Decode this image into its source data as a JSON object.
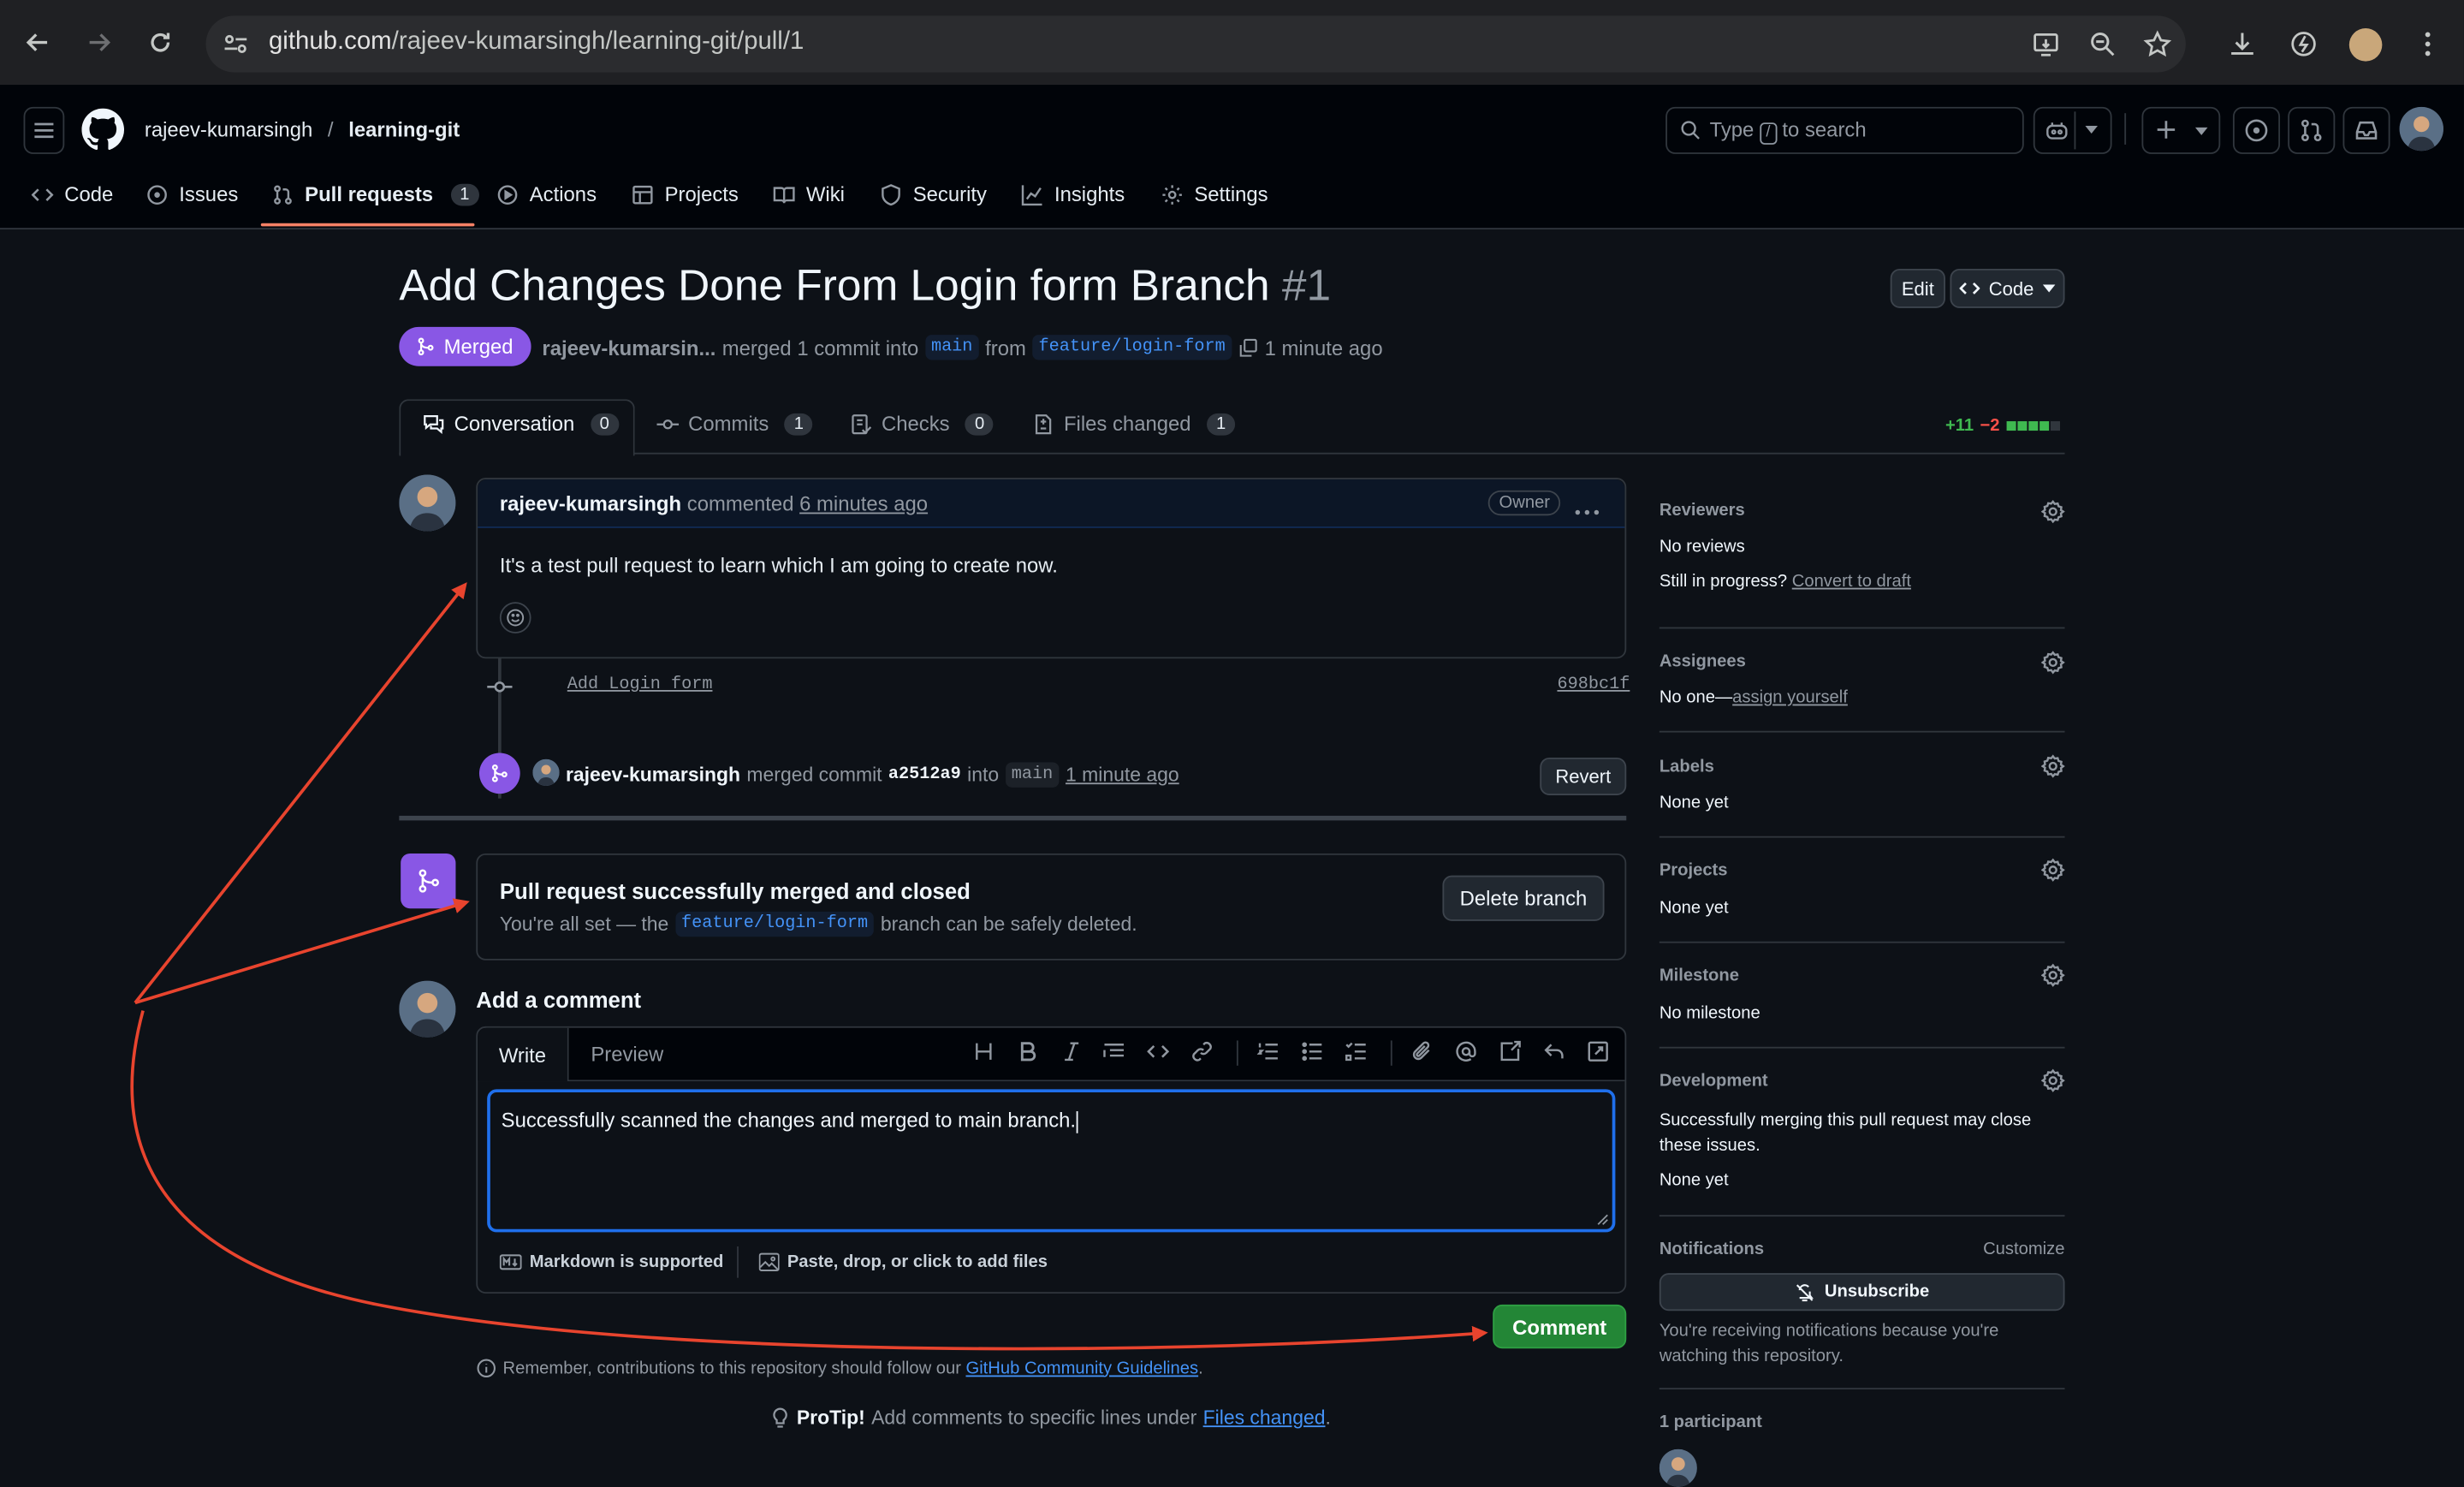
{
  "browser": {
    "url_host": "github.com",
    "url_path": "/rajeev-kumarsingh/learning-git/pull/1"
  },
  "header": {
    "owner": "rajeev-kumarsingh",
    "separator": "/",
    "repo": "learning-git",
    "search_prefix": "Type",
    "search_key": "/",
    "search_suffix": "to search"
  },
  "repo_nav": {
    "items": [
      {
        "label": "Code",
        "icon": "code-icon"
      },
      {
        "label": "Issues",
        "icon": "issue-icon"
      },
      {
        "label": "Pull requests",
        "icon": "pull-request-icon",
        "count": "1"
      },
      {
        "label": "Actions",
        "icon": "play-icon"
      },
      {
        "label": "Projects",
        "icon": "table-icon"
      },
      {
        "label": "Wiki",
        "icon": "book-icon"
      },
      {
        "label": "Security",
        "icon": "shield-icon"
      },
      {
        "label": "Insights",
        "icon": "graph-icon"
      },
      {
        "label": "Settings",
        "icon": "gear-icon"
      }
    ]
  },
  "pr": {
    "title": "Add Changes Done From Login form Branch",
    "number": "#1",
    "edit_label": "Edit",
    "code_label": "Code",
    "state": "Merged",
    "author": "rajeev-kumarsin...",
    "merged_text": "merged 1 commit into",
    "base_branch": "main",
    "from_text": "from",
    "head_branch": "feature/login-form",
    "time": "1 minute ago"
  },
  "tabs": [
    {
      "label": "Conversation",
      "count": "0"
    },
    {
      "label": "Commits",
      "count": "1"
    },
    {
      "label": "Checks",
      "count": "0"
    },
    {
      "label": "Files changed",
      "count": "1"
    }
  ],
  "diffstat": {
    "additions": "+11",
    "deletions": "−2"
  },
  "comment": {
    "author": "rajeev-kumarsingh",
    "action": "commented",
    "time": "6 minutes ago",
    "badge": "Owner",
    "body": "It's a test pull request to learn which I am going to create now."
  },
  "commit": {
    "message": "Add Login form",
    "sha": "698bc1f"
  },
  "merge_event": {
    "author": "rajeev-kumarsingh",
    "text": "merged commit",
    "sha": "a2512a9",
    "into": "into",
    "branch": "main",
    "time": "1 minute ago",
    "revert_label": "Revert"
  },
  "merged_box": {
    "title": "Pull request successfully merged and closed",
    "desc_prefix": "You're all set — the",
    "branch": "feature/login-form",
    "desc_suffix": "branch can be safely deleted.",
    "delete_label": "Delete branch"
  },
  "add_comment": {
    "heading": "Add a comment",
    "write_tab": "Write",
    "preview_tab": "Preview",
    "text": "Successfully scanned the changes and merged to main branch.",
    "markdown_note": "Markdown is supported",
    "files_note": "Paste, drop, or click to add files",
    "submit_label": "Comment",
    "guidelines_prefix": "Remember, contributions to this repository should follow our",
    "guidelines_link": "GitHub Community Guidelines",
    "guidelines_suffix": ".",
    "protip_label": "ProTip!",
    "protip_text": "Add comments to specific lines under",
    "protip_link": "Files changed",
    "protip_suffix": "."
  },
  "sidebar": {
    "reviewers": {
      "title": "Reviewers",
      "value": "No reviews",
      "prompt": "Still in progress?",
      "link": "Convert to draft"
    },
    "assignees": {
      "title": "Assignees",
      "value": "No one—",
      "link": "assign yourself"
    },
    "labels": {
      "title": "Labels",
      "value": "None yet"
    },
    "projects": {
      "title": "Projects",
      "value": "None yet"
    },
    "milestone": {
      "title": "Milestone",
      "value": "No milestone"
    },
    "development": {
      "title": "Development",
      "desc": "Successfully merging this pull request may close these issues.",
      "value": "None yet"
    },
    "notifications": {
      "title": "Notifications",
      "customize": "Customize",
      "button": "Unsubscribe",
      "desc": "You're receiving notifications because you're watching this repository."
    },
    "participants": {
      "title": "1 participant"
    }
  },
  "colors": {
    "merged": "#8957e5",
    "accent_blue": "#4493f8",
    "comment_green": "#238636",
    "annotation_red": "#e8442e"
  }
}
